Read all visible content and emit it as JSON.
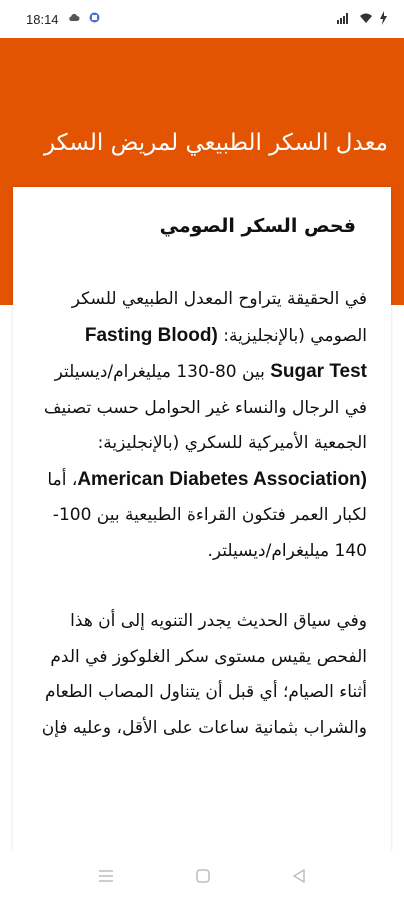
{
  "status_bar": {
    "time": "18:14",
    "left_icons": [
      "cloud-icon",
      "app-icon"
    ],
    "right_icons": [
      "signal-icon",
      "wifi-icon",
      "battery-charging-icon"
    ]
  },
  "header": {
    "title": "معدل السكر الطبيعي لمريض السكر",
    "color": "#e25402"
  },
  "article": {
    "heading": "فحص السكر الصومي",
    "p1_a": " في الحقيقة يتراوح المعدل الطبيعي للسكر الصومي (بالإنجليزية: ",
    "p1_en1": "(Fasting Blood Sugar Test",
    "p1_b": " بين 80-130 ميليغرام/ديسيلتر في الرجال والنساء غير الحوامل حسب تصنيف الجمعية الأميركية للسكري (بالإنجليزية: ",
    "p1_en2": "(American Diabetes Association",
    "p1_c": "، أما لكبار العمر فتكون القراءة الطبيعية بين 100-140 ميليغرام/ديسيلتر.",
    "p2": " وفي سياق الحديث يجدر التنويه إلى أن هذا الفحص يقيس مستوى سكر الغلوكوز في الدم أثناء الصيام؛ أي قبل أن يتناول المصاب الطعام والشراب بثمانية ساعات على الأقل، وعليه فإن"
  },
  "nav_bar": {
    "icons": [
      "menu-icon",
      "home-icon",
      "back-icon"
    ]
  }
}
